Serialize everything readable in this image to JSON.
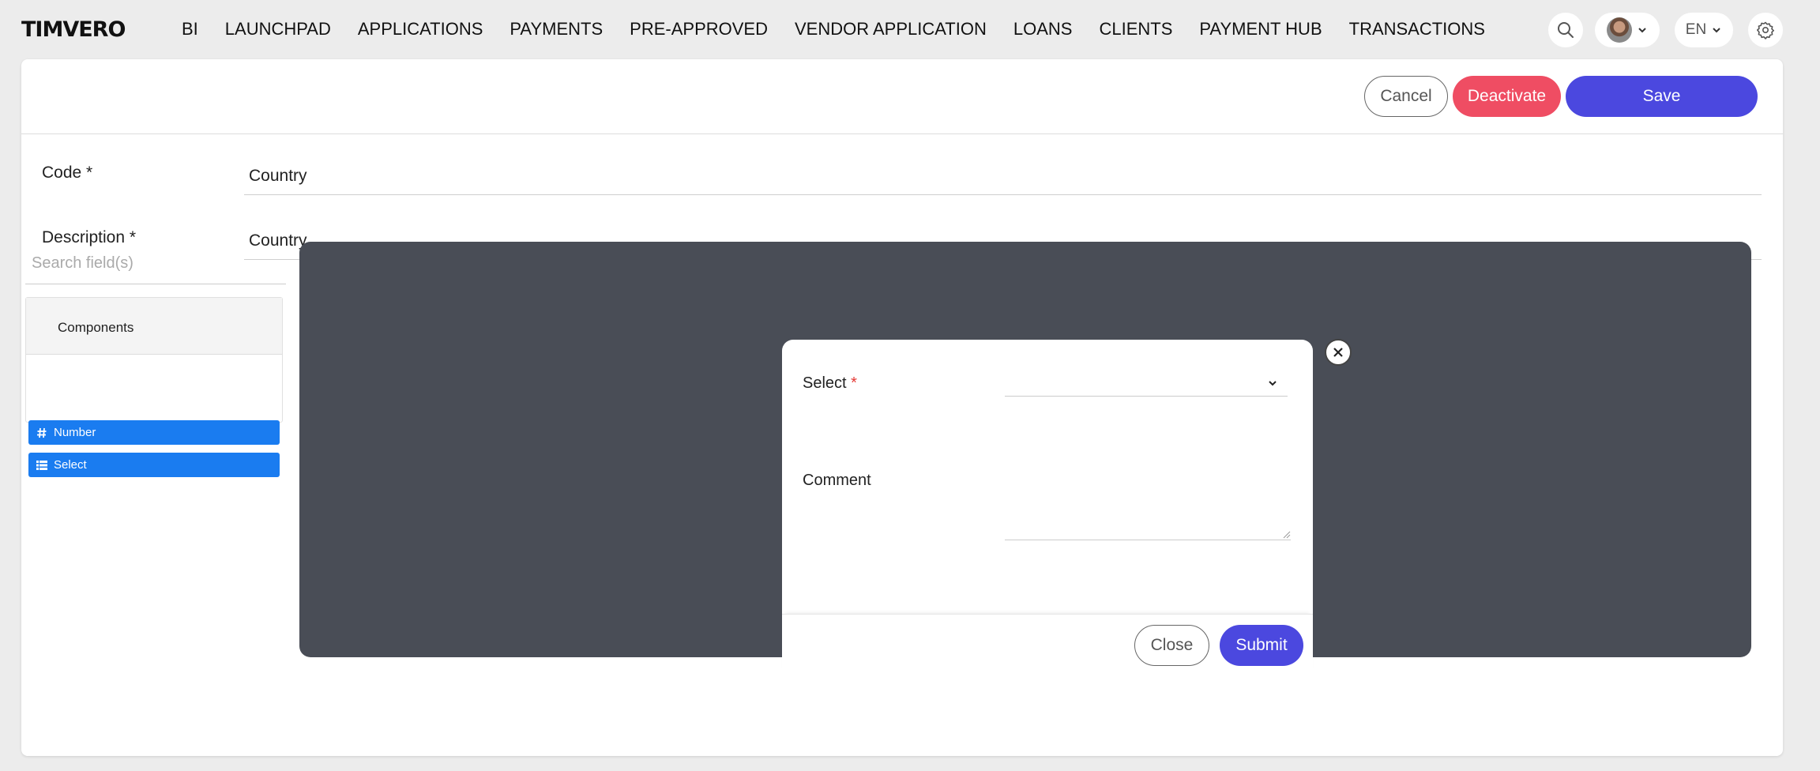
{
  "brand": {
    "logo_text": "TIMVERO"
  },
  "nav": {
    "items": [
      "BI",
      "LAUNCHPAD",
      "APPLICATIONS",
      "PAYMENTS",
      "PRE-APPROVED",
      "VENDOR APPLICATION",
      "LOANS",
      "CLIENTS",
      "PAYMENT HUB",
      "TRANSACTIONS"
    ]
  },
  "header_tools": {
    "language": "EN",
    "icons": [
      "search-icon",
      "avatar",
      "chevron-down-icon",
      "gear-icon"
    ]
  },
  "actions": {
    "cancel": "Cancel",
    "deactivate": "Deactivate",
    "save": "Save"
  },
  "form": {
    "code_label": "Code *",
    "code_value": "Country",
    "description_label": "Description *",
    "description_value": "Country"
  },
  "builder": {
    "search_placeholder": "Search field(s)",
    "components_title": "Components",
    "components": [
      {
        "label": "Number",
        "icon": "hash-icon"
      },
      {
        "label": "Select",
        "icon": "list-icon"
      }
    ]
  },
  "modal": {
    "select_label": "Select",
    "required_mark": "*",
    "select_value": "",
    "comment_label": "Comment",
    "comment_value": "",
    "close": "Close",
    "submit": "Submit"
  },
  "colors": {
    "primary": "#4b48df",
    "danger": "#ef4d63",
    "component": "#1a7cf0",
    "canvas": "#494d56"
  }
}
